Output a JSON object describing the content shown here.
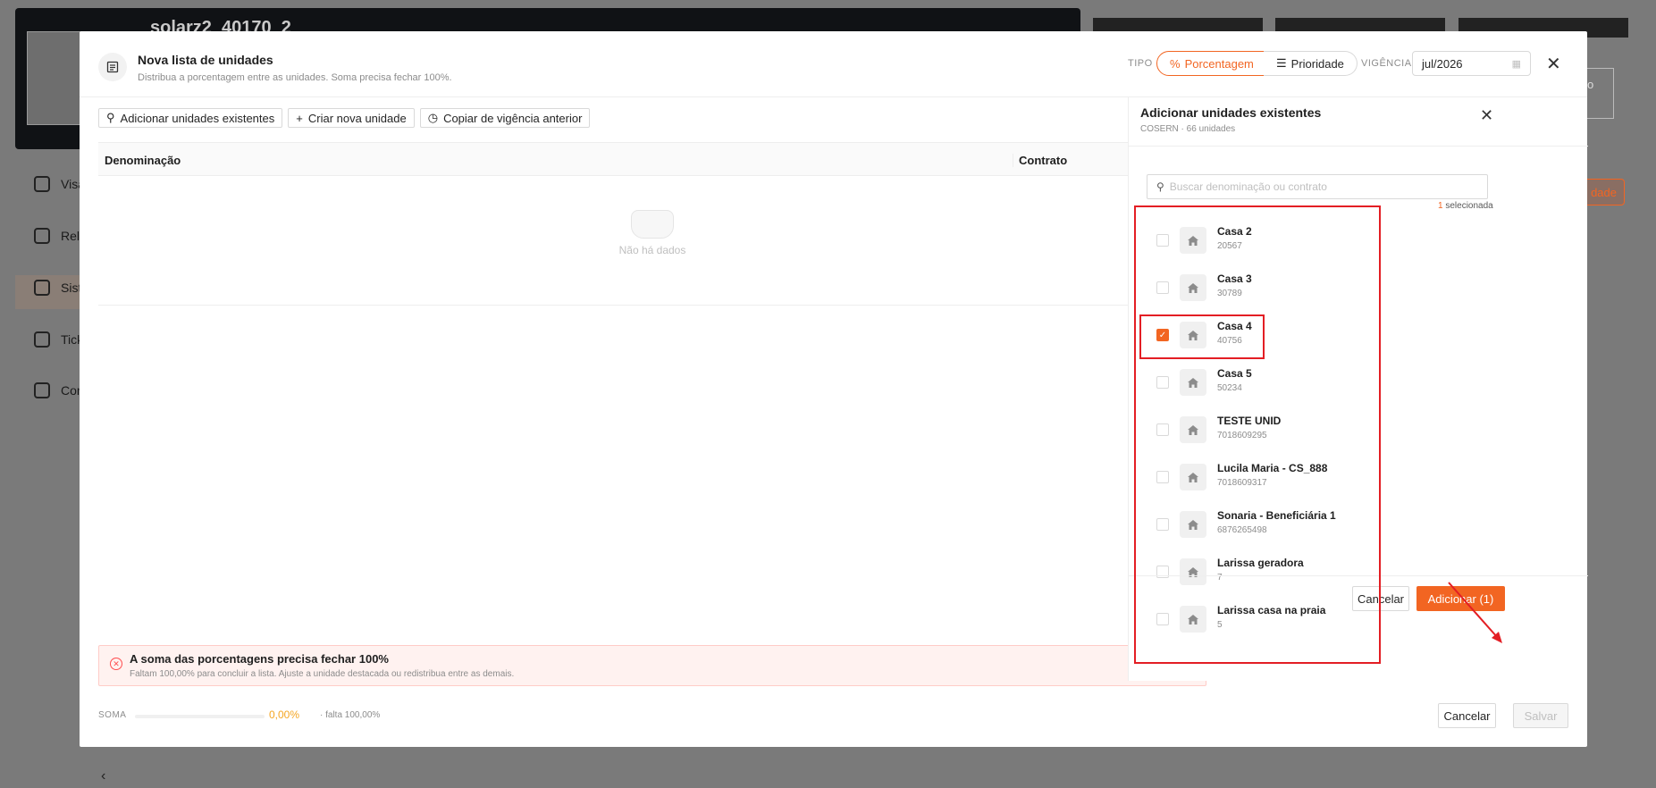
{
  "background": {
    "title": "solarz2_40170_2",
    "nav": [
      "Visã",
      "Rela",
      "Siste",
      "Tick",
      "Con"
    ],
    "action_label": "dade",
    "pro_label": "Pro"
  },
  "modal": {
    "title": "Nova lista de unidades",
    "subtitle": "Distribua a porcentagem entre as unidades. Soma precisa fechar 100%.",
    "tipo_label": "TIPO",
    "tipo_options": [
      "Porcentagem",
      "Prioridade"
    ],
    "vigencia_label": "VIGÊNCIA",
    "vigencia_value": "jul/2026",
    "toolbar": {
      "add_existing": "Adicionar unidades existentes",
      "create_new": "Criar nova unidade",
      "copy_prev": "Copiar de vigência anterior"
    },
    "table": {
      "columns": [
        "Denominação",
        "Contrato"
      ],
      "empty_text": "Não há dados"
    },
    "alert": {
      "title": "A soma das porcentagens precisa fechar 100%",
      "text": "Faltam 100,00% para concluir a lista. Ajuste a unidade destacada ou redistribua entre as demais."
    },
    "soma": {
      "label": "SOMA",
      "value": "0,00%",
      "missing": "· falta 100,00%",
      "progress": 0
    },
    "footer": {
      "cancel": "Cancelar",
      "save": "Salvar"
    }
  },
  "panel": {
    "title": "Adicionar unidades existentes",
    "subtitle": "COSERN · 66 unidades",
    "search_placeholder": "Buscar denominação ou contrato",
    "selected_count": "1",
    "selected_label": "selecionada",
    "items": [
      {
        "name": "Casa 2",
        "code": "20567",
        "checked": false
      },
      {
        "name": "Casa 3",
        "code": "30789",
        "checked": false
      },
      {
        "name": "Casa 4",
        "code": "40756",
        "checked": true
      },
      {
        "name": "Casa 5",
        "code": "50234",
        "checked": false
      },
      {
        "name": "TESTE UNID",
        "code": "7018609295",
        "checked": false
      },
      {
        "name": "Lucila Maria - CS_888",
        "code": "7018609317",
        "checked": false
      },
      {
        "name": "Sonaria - Beneficiária 1",
        "code": "6876265498",
        "checked": false
      },
      {
        "name": "Larissa geradora",
        "code": "7",
        "checked": false
      },
      {
        "name": "Larissa casa na praia",
        "code": "5",
        "checked": false
      }
    ],
    "cancel": "Cancelar",
    "add": "Adicionar (1)"
  },
  "colors": {
    "accent": "#f26522",
    "annotation": "#e31e24"
  },
  "icons": [
    "list-icon",
    "percent-icon",
    "priority-list-icon",
    "calendar-icon",
    "close-icon",
    "search-icon",
    "plus-icon",
    "history-icon",
    "home-icon",
    "error-icon",
    "check-icon"
  ]
}
